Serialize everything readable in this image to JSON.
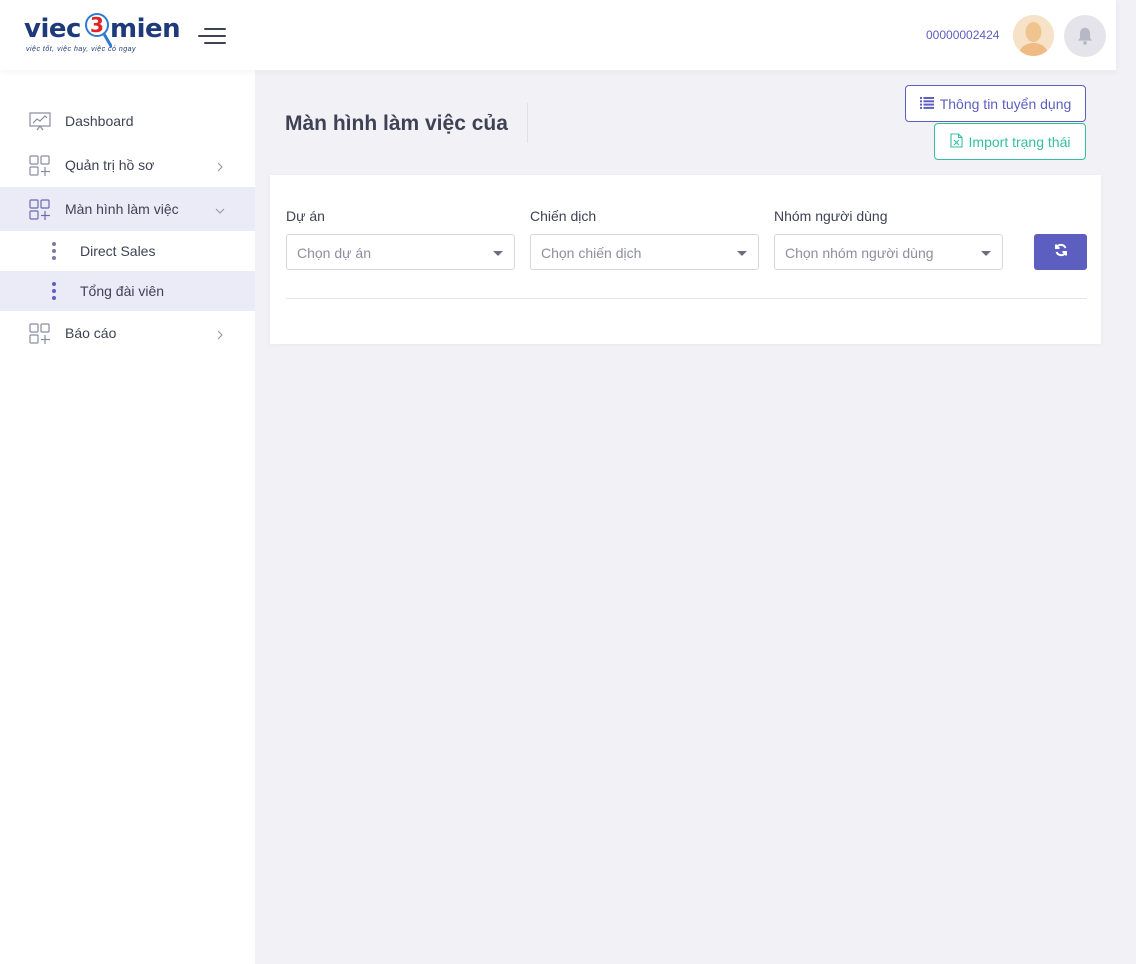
{
  "header": {
    "logo": {
      "word_left": "viec",
      "digit": "3",
      "word_right": "mien",
      "tagline": "việc tốt, việc hay, việc có ngay"
    },
    "user_id": "00000002424",
    "icons": [
      "menu-toggle-icon",
      "avatar",
      "bell-icon"
    ]
  },
  "sidebar": {
    "items": [
      {
        "label": "Dashboard",
        "icon": "chart-presentation-icon"
      },
      {
        "label": "Quản trị hồ sơ",
        "icon": "apps-grid-icon"
      },
      {
        "label": "Màn hình làm việc",
        "icon": "apps-grid-icon",
        "expanded": true
      },
      {
        "label": "Báo cáo",
        "icon": "apps-grid-icon"
      }
    ],
    "subitems": [
      {
        "label": "Direct Sales"
      },
      {
        "label": "Tổng đài viên",
        "active": true
      }
    ]
  },
  "main": {
    "title": "Màn hình làm việc của",
    "buttons": {
      "info": "Thông tin tuyển dụng",
      "import": "Import trạng thái"
    },
    "filters": [
      {
        "label": "Dự án",
        "placeholder": "Chọn dự án"
      },
      {
        "label": "Chiến dịch",
        "placeholder": "Chọn chiến dịch"
      },
      {
        "label": "Nhóm người dùng",
        "placeholder": "Chọn nhóm người dùng"
      }
    ],
    "colors": {
      "primary": "#5d5fc0",
      "success": "#34bfa3"
    }
  }
}
